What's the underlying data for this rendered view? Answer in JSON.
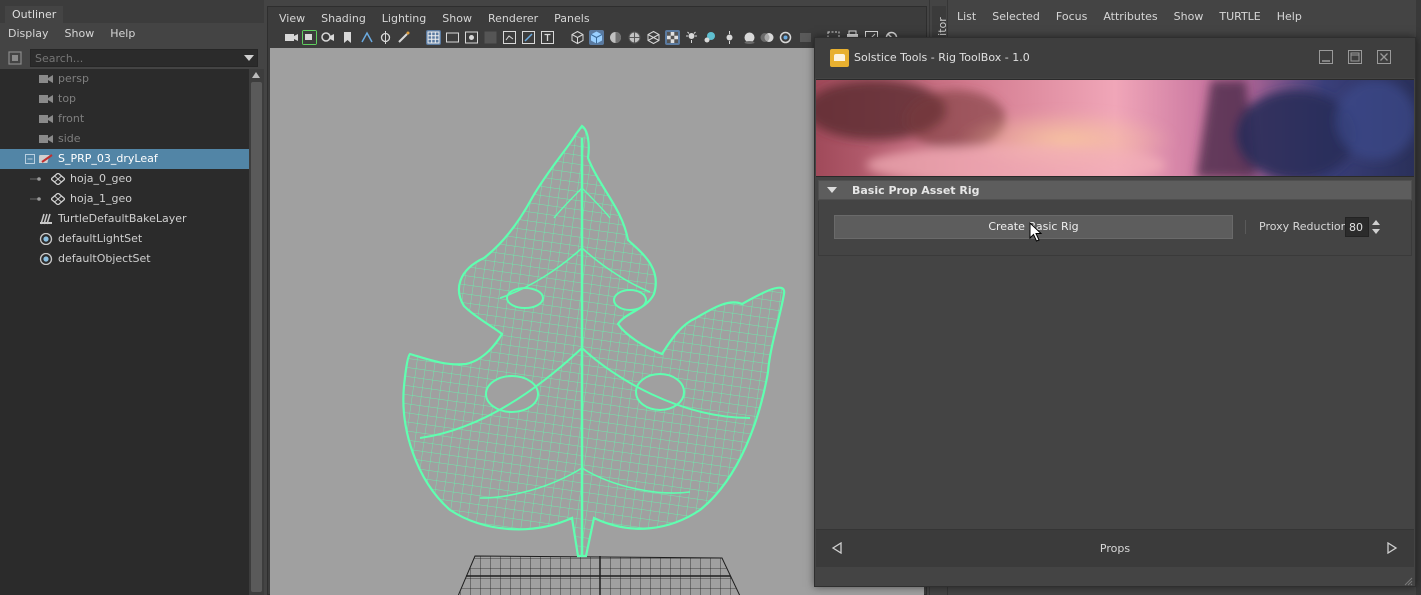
{
  "outliner": {
    "tab_label": "Outliner",
    "menu": [
      "Display",
      "Show",
      "Help"
    ],
    "search_placeholder": "Search...",
    "items": [
      {
        "label": "persp",
        "icon": "camera-icon",
        "dim": true
      },
      {
        "label": "top",
        "icon": "camera-icon",
        "dim": true
      },
      {
        "label": "front",
        "icon": "camera-icon",
        "dim": true
      },
      {
        "label": "side",
        "icon": "camera-icon",
        "dim": true
      },
      {
        "label": "S_PRP_03_dryLeaf",
        "icon": "group-icon",
        "selected": true
      },
      {
        "label": "hoja_0_geo",
        "icon": "mesh-icon"
      },
      {
        "label": "hoja_1_geo",
        "icon": "mesh-icon"
      },
      {
        "label": "TurtleDefaultBakeLayer",
        "icon": "bake-layer-icon"
      },
      {
        "label": "defaultLightSet",
        "icon": "set-icon"
      },
      {
        "label": "defaultObjectSet",
        "icon": "set-icon"
      }
    ]
  },
  "viewport": {
    "menu": [
      "View",
      "Shading",
      "Lighting",
      "Show",
      "Renderer",
      "Panels"
    ],
    "wire_color": "#5fffb0",
    "background_color": "#a0a0a0"
  },
  "attribute_editor": {
    "tab_label": "itor",
    "menu": [
      "List",
      "Selected",
      "Focus",
      "Attributes",
      "Show",
      "TURTLE",
      "Help"
    ]
  },
  "tool_window": {
    "title": "Solstice Tools - Rig ToolBox - 1.0",
    "section_label": "Basic Prop Asset Rig",
    "create_button_label": "Create Basic Rig",
    "proxy_label": "Proxy Reduction:",
    "proxy_value": "80",
    "footer_label": "Props",
    "accent_color": "#e8b030"
  }
}
